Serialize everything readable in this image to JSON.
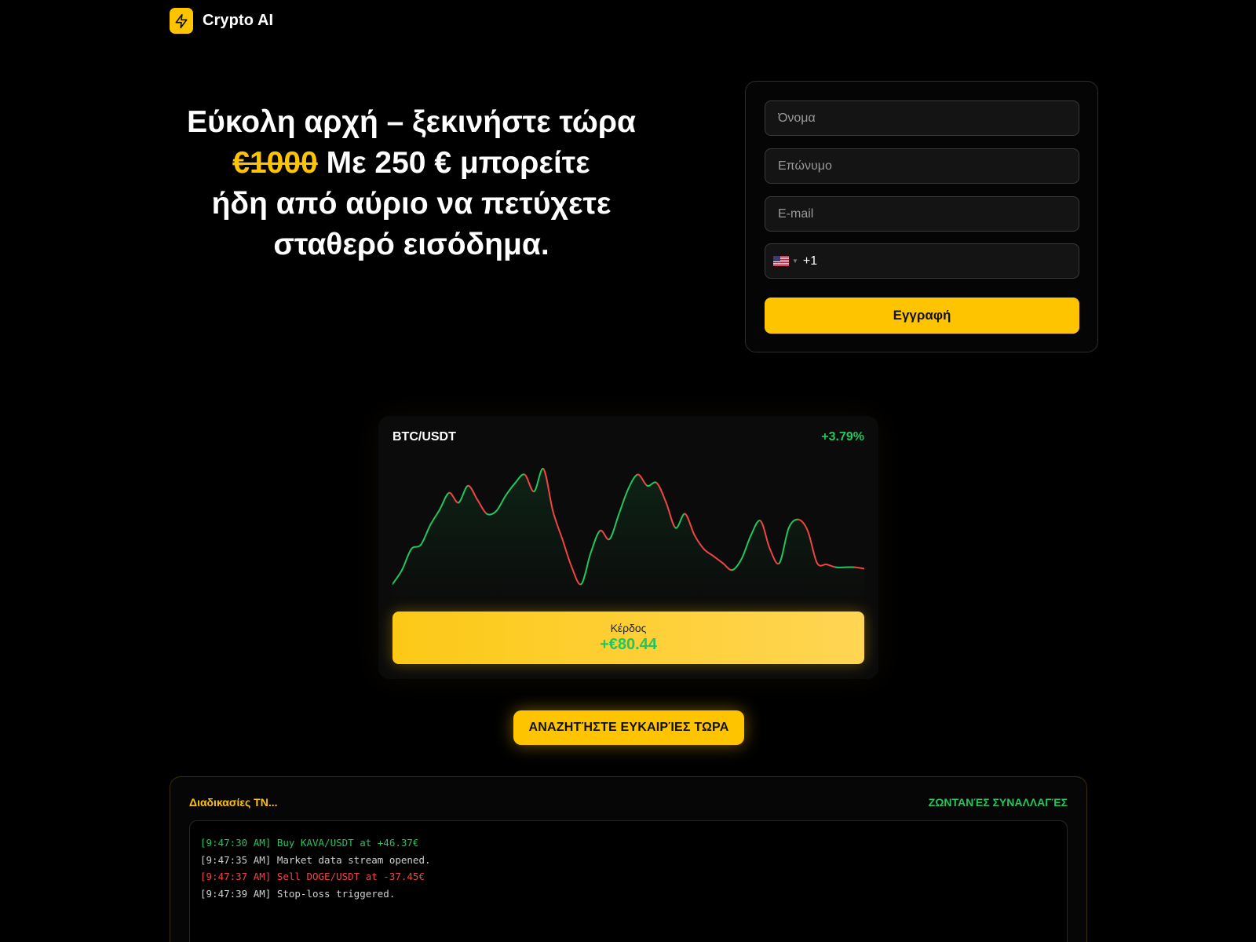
{
  "brand": {
    "name": "Crypto AI",
    "icon": "lightning-icon"
  },
  "hero": {
    "line1": "Εύκολη αρχή – ξεκινήστε τώρα",
    "strike": "€1000",
    "line2_rest": " Με 250 € μπορείτε",
    "line3": "ήδη από αύριο να πετύχετε",
    "line4": "σταθερό εισόδημα."
  },
  "form": {
    "first_name_placeholder": "Όνομα",
    "last_name_placeholder": "Επώνυμο",
    "email_placeholder": "E-mail",
    "phone_code": "+1",
    "country_flag": "us-flag-icon",
    "submit_label": "Εγγραφή"
  },
  "chart_card": {
    "pair": "BTC/USDT",
    "change": "+3.79%",
    "profit_label": "Κέρδος",
    "profit_value": "+€80.44"
  },
  "chart_data": {
    "type": "line",
    "x": [
      0,
      2,
      4,
      6,
      8,
      10,
      12,
      14,
      16,
      18,
      20,
      22,
      24,
      26,
      28,
      30,
      32,
      34,
      36,
      38,
      40,
      42,
      44,
      46,
      48,
      50,
      52,
      54,
      56,
      58,
      60,
      62,
      64,
      66,
      68,
      70,
      72,
      74,
      76,
      78,
      80,
      82,
      84,
      86,
      88,
      90,
      92,
      94,
      96,
      98,
      100
    ],
    "values": [
      10,
      20,
      35,
      38,
      52,
      63,
      75,
      68,
      80,
      70,
      60,
      62,
      73,
      82,
      88,
      76,
      92,
      62,
      42,
      22,
      10,
      32,
      48,
      42,
      60,
      78,
      88,
      80,
      82,
      68,
      50,
      60,
      45,
      35,
      30,
      25,
      20,
      28,
      45,
      55,
      35,
      25,
      50,
      56,
      48,
      25,
      24,
      22,
      22,
      22,
      21
    ],
    "series_colors": {
      "up": "#22c55e",
      "down": "#ef4444"
    }
  },
  "cta": {
    "label": "ΑΝΑΖΗΤΉΣΤΕ ΕΥΚΑΙΡΊΕΣ ΤΩΡΑ"
  },
  "terminal": {
    "title": "Διαδικασίες ΤΝ...",
    "live_label": "ΖΩΝΤΑΝΈΣ ΣΥΝΑΛΛΑΓΈΣ",
    "logs": [
      {
        "text": "[9:47:30 AM] Buy KAVA/USDT at +46.37€",
        "color": "#22c55e"
      },
      {
        "text": "[9:47:35 AM] Market data stream opened.",
        "color": "#cfcfcf"
      },
      {
        "text": "[9:47:37 AM] Sell DOGE/USDT at -37.45€",
        "color": "#ef4444"
      },
      {
        "text": "[9:47:39 AM] Stop-loss triggered.",
        "color": "#cfcfcf"
      }
    ]
  }
}
